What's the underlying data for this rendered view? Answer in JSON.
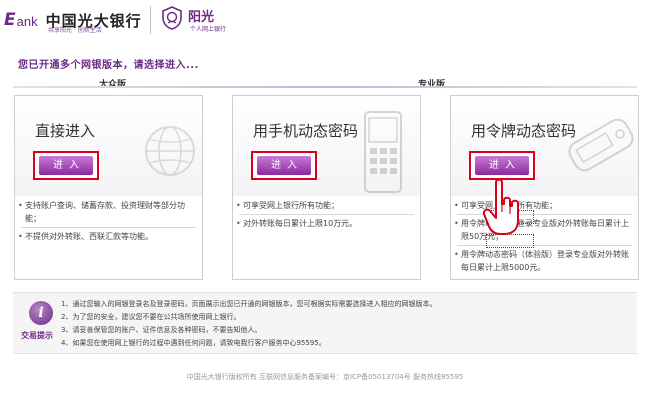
{
  "header": {
    "logo_e": "E",
    "logo_bank": "ank",
    "bank_name": "中国光大银行",
    "slogan": "共享阳光 · 创新生活",
    "badge_title": "阳光",
    "badge_subtitle": "个人网上银行",
    "accent": "#6b2a86"
  },
  "prompt": "您已开通多个网银版本，请选择进入...",
  "sections": {
    "mass": "大众版",
    "pro": "专业版"
  },
  "cards": [
    {
      "title": "直接进入",
      "button": "进入",
      "icon": "globe-icon",
      "lines": [
        "支持账户查询、储蓄存款、投资理财等部分功能；",
        "不提供对外转账、西联汇款等功能。"
      ]
    },
    {
      "title": "用手机动态密码",
      "button": "进入",
      "icon": "phone-icon",
      "lines": [
        "可享受网上银行所有功能；",
        "对外转账每日累计上限10万元。"
      ]
    },
    {
      "title": "用令牌动态密码",
      "button": "进入",
      "icon": "token-icon",
      "lines": [
        "可享受网上银行所有功能；",
        "用令牌动态密码登录专业版对外转账每日累计上限50万元；",
        "用令牌动态密码（体验版）登录专业版对外转账每日累计上限5000元。"
      ]
    }
  ],
  "tips": {
    "label": "交易提示",
    "items": [
      "1、通过您输入的网银登录名及登录密码，页面展示出您已开通的网银版本，您可根据实际需要选择进入相应的网银版本。",
      "2、为了您的安全，建议您不要在公共场所使用网上银行。",
      "3、请妥善保管您的账户、证件信息及各种密码，不要告知他人。",
      "4、如果您在使用网上银行的过程中遇到任何问题，请致电我行客户服务中心95595。"
    ]
  },
  "footer": "中国光大银行版权所有  互联网信息服务备案编号：京ICP备05013704号  服务热线95595"
}
